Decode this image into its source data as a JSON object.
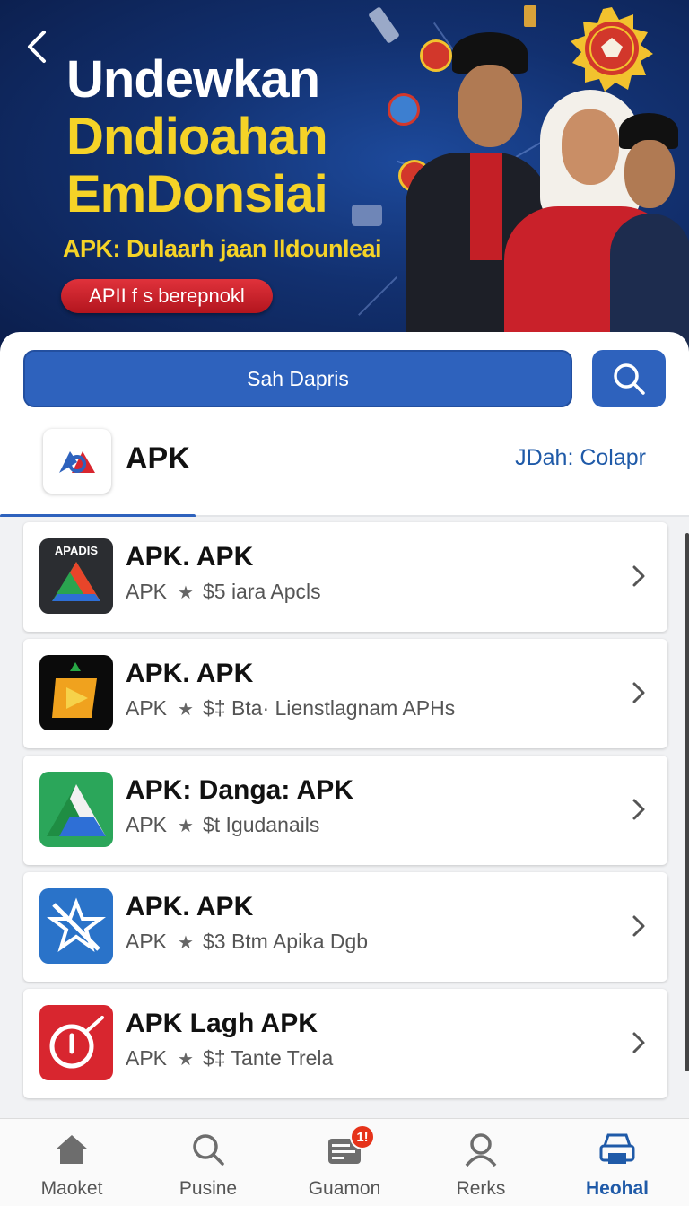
{
  "hero": {
    "title_line1": "Undewkan",
    "title_line2": "Dndioahan",
    "title_line3": "EmDonsiai",
    "subtitle": "APK: Dulaarh jaan Ildounleai",
    "cta_label": "APII f s berepnokl",
    "back_icon": "chevron-left-icon"
  },
  "search": {
    "placeholder": "Sah Dapris",
    "button_icon": "search-icon"
  },
  "section": {
    "title": "APK",
    "link_label": "JDah: Colapr"
  },
  "apps": [
    {
      "name": "APK. APK",
      "category": "APK",
      "detail": "$5 iara Apcls",
      "icon": "apadis-logo-icon",
      "icon_text": "APADIS"
    },
    {
      "name": "APK. APK",
      "category": "APK",
      "detail": "$‡ Bta· Lienstlagnam APHs",
      "icon": "play-arrow-icon"
    },
    {
      "name": "APK: Danga: APK",
      "category": "APK",
      "detail": "$t Igudanails",
      "icon": "drive-triangle-icon"
    },
    {
      "name": "APK. APK",
      "category": "APK",
      "detail": "$3 Btm Apika Dgb",
      "icon": "star-slash-icon"
    },
    {
      "name": "APK Lagh APK",
      "category": "APK",
      "detail": "$‡ Tante Trela",
      "icon": "red-dial-icon"
    }
  ],
  "nav": [
    {
      "label": "Maoket",
      "icon": "home-icon",
      "active": false
    },
    {
      "label": "Pusine",
      "icon": "search-icon",
      "active": false
    },
    {
      "label": "Guamon",
      "icon": "inbox-icon",
      "active": false,
      "badge": "1!"
    },
    {
      "label": "Rerks",
      "icon": "person-icon",
      "active": false
    },
    {
      "label": "Heohal",
      "icon": "printer-icon",
      "active": true
    }
  ],
  "colors": {
    "primary": "#2e62bd",
    "accent_yellow": "#f5d327",
    "cta_red": "#c91f28",
    "link_blue": "#1f5aa8"
  }
}
